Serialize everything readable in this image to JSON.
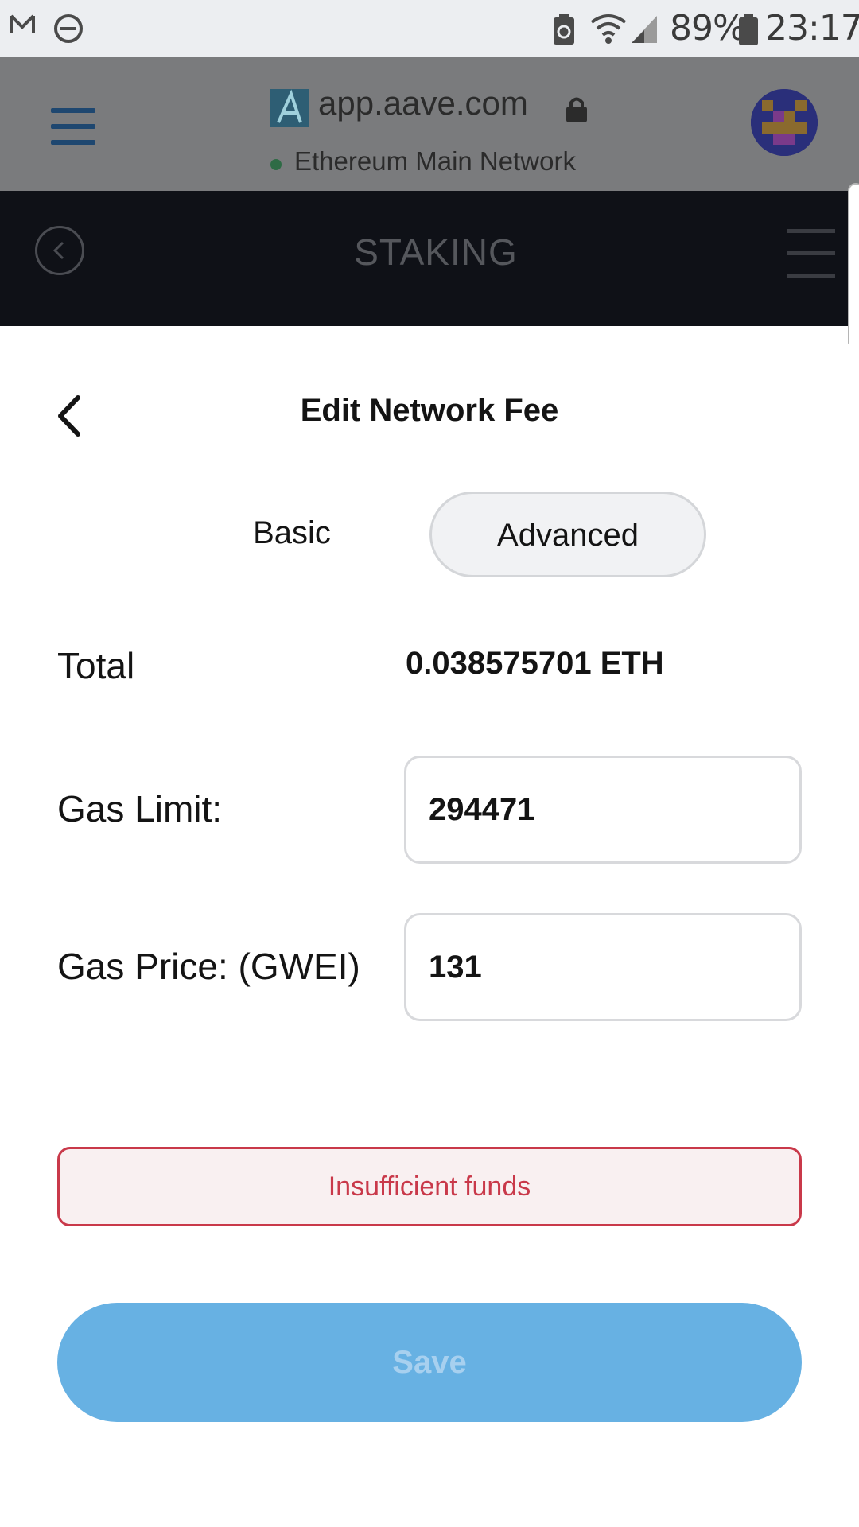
{
  "status_bar": {
    "battery_percent": "89%",
    "time": "23:17"
  },
  "browser": {
    "url": "app.aave.com",
    "network": "Ethereum Main Network"
  },
  "page": {
    "title": "STAKING"
  },
  "sheet": {
    "title": "Edit Network Fee",
    "tabs": [
      {
        "label": "Basic",
        "selected": false
      },
      {
        "label": "Advanced",
        "selected": true
      }
    ],
    "total": {
      "label": "Total",
      "value": "0.038575701 ETH"
    },
    "gas_limit": {
      "label": "Gas Limit:",
      "value": "294471"
    },
    "gas_price": {
      "label": "Gas Price: (GWEI)",
      "value": "131"
    },
    "error": "Insufficient funds",
    "save_label": "Save"
  },
  "colors": {
    "accent": "#67b1e3",
    "error": "#c9394a"
  },
  "icons": [
    "gmail-icon",
    "dnd-icon",
    "battery-saver-icon",
    "wifi-icon",
    "signal-icon",
    "battery-icon",
    "hamburger-icon",
    "lock-icon",
    "chevron-left-icon",
    "menu-icon"
  ]
}
